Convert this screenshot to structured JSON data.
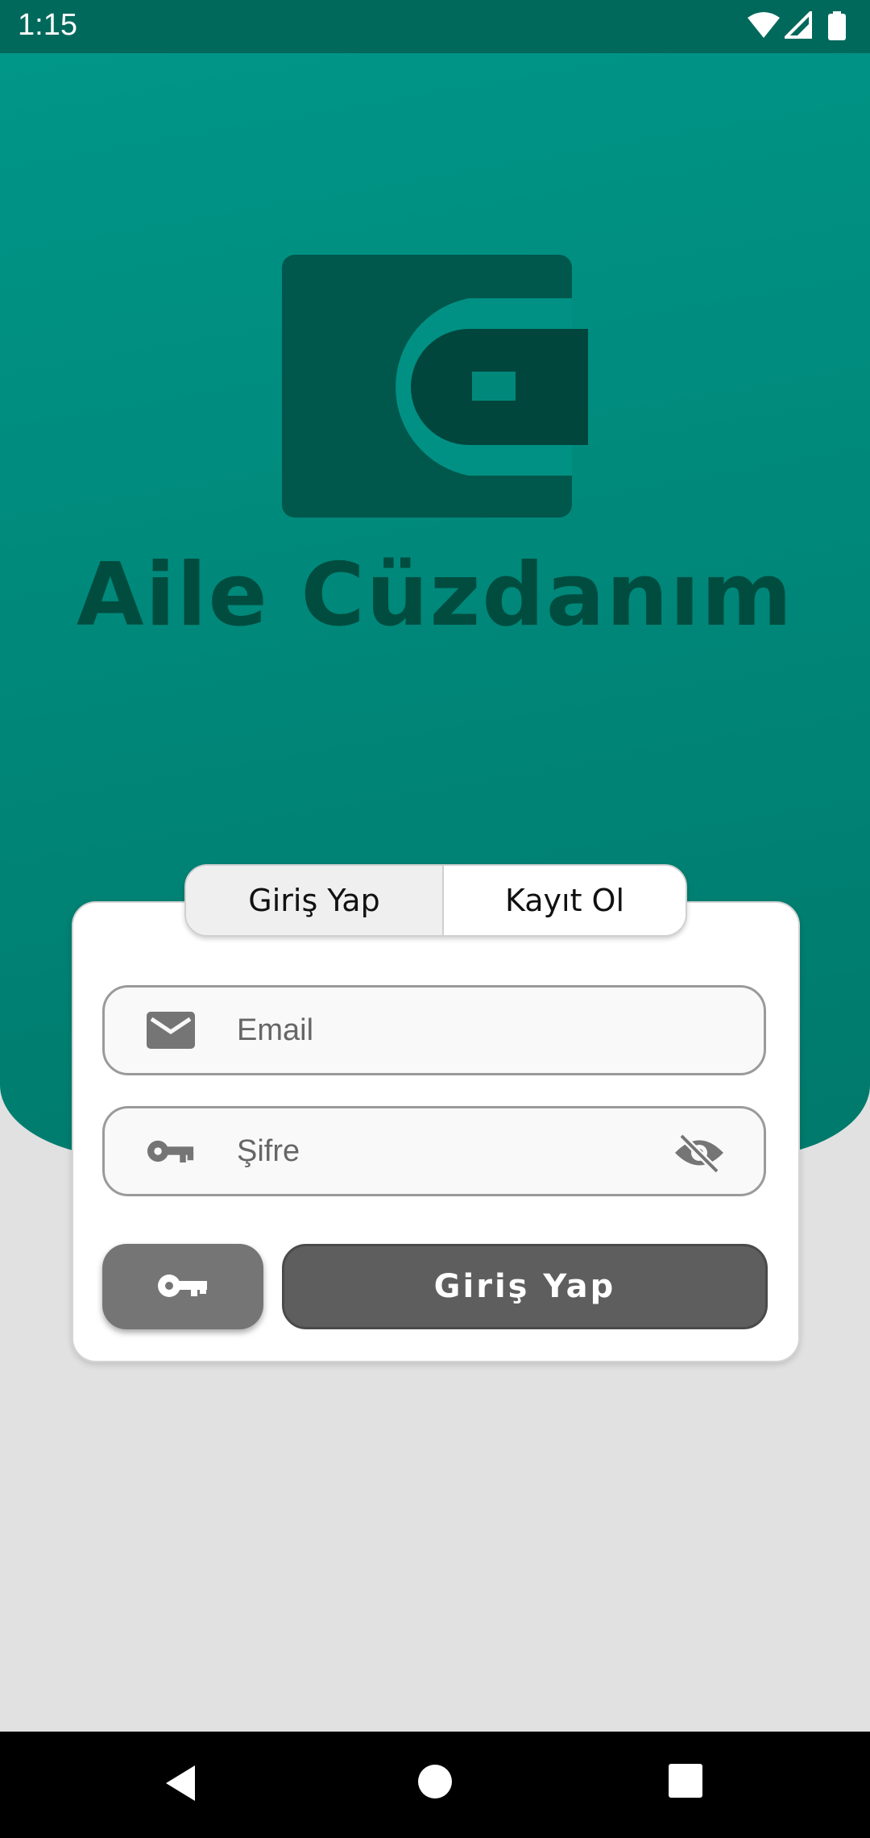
{
  "status_bar": {
    "time": "1:15",
    "icons": [
      "wifi-icon",
      "signal-icon",
      "battery-icon"
    ]
  },
  "header": {
    "app_title": "Aile Cüzdanım",
    "logo": "wallet-icon"
  },
  "tabs": [
    {
      "label": "Giriş Yap",
      "selected": true
    },
    {
      "label": "Kayıt Ol",
      "selected": false
    }
  ],
  "form": {
    "email": {
      "placeholder": "Email",
      "value": "",
      "icon": "envelope-icon"
    },
    "password": {
      "placeholder": "Şifre",
      "value": "",
      "icon": "key-icon",
      "toggle_icon": "eye-off-icon"
    },
    "key_button_icon": "key-icon",
    "login_label": "Giriş Yap"
  },
  "nav_bar": {
    "icons": [
      "back-icon",
      "home-icon",
      "recents-icon"
    ]
  },
  "colors": {
    "header_teal": "#009688",
    "header_teal_dark": "#00796b",
    "status_bar": "#00695c",
    "title_dark_green": "#004d40",
    "background": "#e1e1e1",
    "button_dark_grey": "#5e5e5e"
  }
}
